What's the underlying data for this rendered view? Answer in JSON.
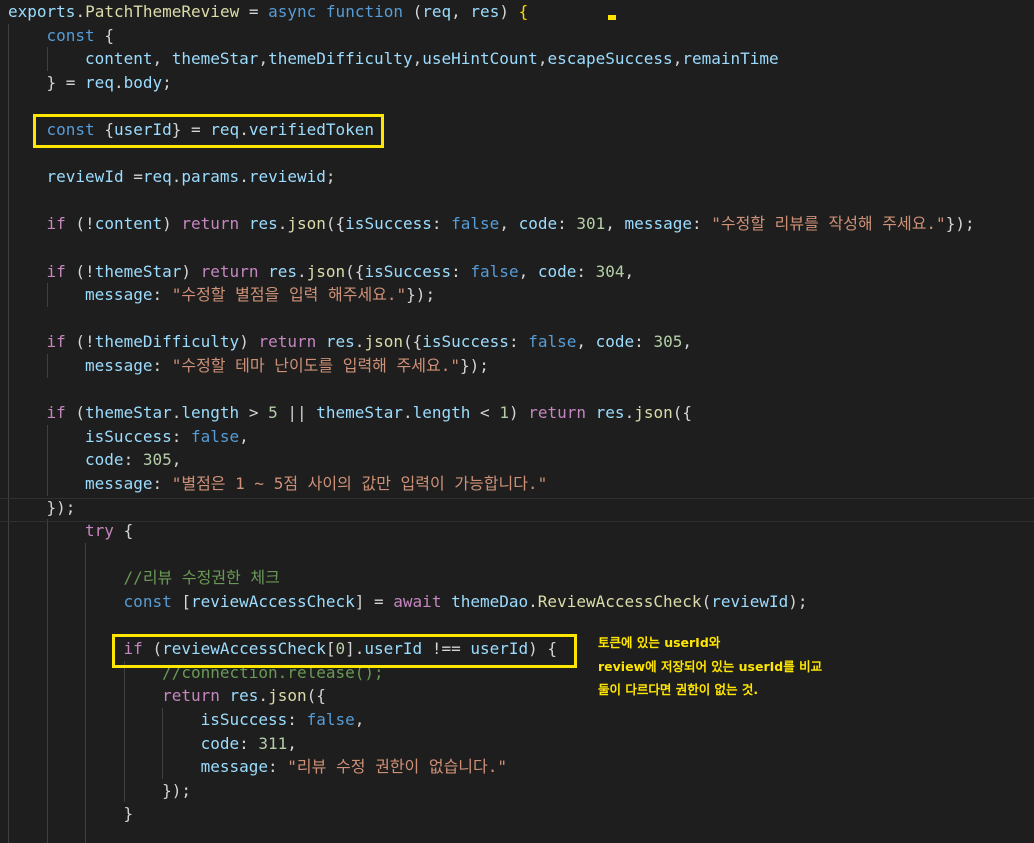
{
  "code_lines": [
    {
      "indent": 0,
      "tokens": [
        {
          "t": "exports",
          "c": "var"
        },
        {
          "t": ".",
          "c": "punc"
        },
        {
          "t": "PatchThemeReview",
          "c": "fn"
        },
        {
          "t": " = ",
          "c": "punc"
        },
        {
          "t": "async",
          "c": "kw"
        },
        {
          "t": " ",
          "c": "punc"
        },
        {
          "t": "function",
          "c": "kw"
        },
        {
          "t": " (",
          "c": "punc"
        },
        {
          "t": "req",
          "c": "var"
        },
        {
          "t": ", ",
          "c": "punc"
        },
        {
          "t": "res",
          "c": "var"
        },
        {
          "t": ") ",
          "c": "punc"
        },
        {
          "t": "{",
          "c": "brace"
        }
      ]
    },
    {
      "indent": 4,
      "tokens": [
        {
          "t": "const",
          "c": "kw"
        },
        {
          "t": " {",
          "c": "punc"
        }
      ]
    },
    {
      "indent": 8,
      "tokens": [
        {
          "t": "content",
          "c": "var"
        },
        {
          "t": ", ",
          "c": "punc"
        },
        {
          "t": "themeStar",
          "c": "var"
        },
        {
          "t": ",",
          "c": "punc"
        },
        {
          "t": "themeDifficulty",
          "c": "var"
        },
        {
          "t": ",",
          "c": "punc"
        },
        {
          "t": "useHintCount",
          "c": "var"
        },
        {
          "t": ",",
          "c": "punc"
        },
        {
          "t": "escapeSuccess",
          "c": "var"
        },
        {
          "t": ",",
          "c": "punc"
        },
        {
          "t": "remainTime",
          "c": "var"
        }
      ]
    },
    {
      "indent": 4,
      "tokens": [
        {
          "t": "} = ",
          "c": "punc"
        },
        {
          "t": "req",
          "c": "var"
        },
        {
          "t": ".",
          "c": "punc"
        },
        {
          "t": "body",
          "c": "prop"
        },
        {
          "t": ";",
          "c": "punc"
        }
      ]
    },
    {
      "indent": 0,
      "tokens": []
    },
    {
      "indent": 4,
      "tokens": [
        {
          "t": "const",
          "c": "kw"
        },
        {
          "t": " {",
          "c": "punc"
        },
        {
          "t": "userId",
          "c": "var"
        },
        {
          "t": "} = ",
          "c": "punc"
        },
        {
          "t": "req",
          "c": "var"
        },
        {
          "t": ".",
          "c": "punc"
        },
        {
          "t": "verifiedToken",
          "c": "prop"
        }
      ]
    },
    {
      "indent": 0,
      "tokens": []
    },
    {
      "indent": 4,
      "tokens": [
        {
          "t": "reviewId",
          "c": "var"
        },
        {
          "t": " =",
          "c": "punc"
        },
        {
          "t": "req",
          "c": "var"
        },
        {
          "t": ".",
          "c": "punc"
        },
        {
          "t": "params",
          "c": "prop"
        },
        {
          "t": ".",
          "c": "punc"
        },
        {
          "t": "reviewid",
          "c": "prop"
        },
        {
          "t": ";",
          "c": "punc"
        }
      ]
    },
    {
      "indent": 0,
      "tokens": []
    },
    {
      "indent": 4,
      "tokens": [
        {
          "t": "if",
          "c": "ctl"
        },
        {
          "t": " (!",
          "c": "punc"
        },
        {
          "t": "content",
          "c": "var"
        },
        {
          "t": ") ",
          "c": "punc"
        },
        {
          "t": "return",
          "c": "ctl"
        },
        {
          "t": " ",
          "c": "punc"
        },
        {
          "t": "res",
          "c": "var"
        },
        {
          "t": ".",
          "c": "punc"
        },
        {
          "t": "json",
          "c": "fn"
        },
        {
          "t": "({",
          "c": "punc"
        },
        {
          "t": "isSuccess",
          "c": "prop"
        },
        {
          "t": ": ",
          "c": "punc"
        },
        {
          "t": "false",
          "c": "kw"
        },
        {
          "t": ", ",
          "c": "punc"
        },
        {
          "t": "code",
          "c": "prop"
        },
        {
          "t": ": ",
          "c": "punc"
        },
        {
          "t": "301",
          "c": "num"
        },
        {
          "t": ", ",
          "c": "punc"
        },
        {
          "t": "message",
          "c": "prop"
        },
        {
          "t": ": ",
          "c": "punc"
        },
        {
          "t": "\"수정할 리뷰를 작성해 주세요.\"",
          "c": "str"
        },
        {
          "t": "});",
          "c": "punc"
        }
      ]
    },
    {
      "indent": 0,
      "tokens": []
    },
    {
      "indent": 4,
      "tokens": [
        {
          "t": "if",
          "c": "ctl"
        },
        {
          "t": " (!",
          "c": "punc"
        },
        {
          "t": "themeStar",
          "c": "var"
        },
        {
          "t": ") ",
          "c": "punc"
        },
        {
          "t": "return",
          "c": "ctl"
        },
        {
          "t": " ",
          "c": "punc"
        },
        {
          "t": "res",
          "c": "var"
        },
        {
          "t": ".",
          "c": "punc"
        },
        {
          "t": "json",
          "c": "fn"
        },
        {
          "t": "({",
          "c": "punc"
        },
        {
          "t": "isSuccess",
          "c": "prop"
        },
        {
          "t": ": ",
          "c": "punc"
        },
        {
          "t": "false",
          "c": "kw"
        },
        {
          "t": ", ",
          "c": "punc"
        },
        {
          "t": "code",
          "c": "prop"
        },
        {
          "t": ": ",
          "c": "punc"
        },
        {
          "t": "304",
          "c": "num"
        },
        {
          "t": ",",
          "c": "punc"
        }
      ]
    },
    {
      "indent": 8,
      "tokens": [
        {
          "t": "message",
          "c": "prop"
        },
        {
          "t": ": ",
          "c": "punc"
        },
        {
          "t": "\"수정할 별점을 입력 해주세요.\"",
          "c": "str"
        },
        {
          "t": "});",
          "c": "punc"
        }
      ]
    },
    {
      "indent": 0,
      "tokens": []
    },
    {
      "indent": 4,
      "tokens": [
        {
          "t": "if",
          "c": "ctl"
        },
        {
          "t": " (!",
          "c": "punc"
        },
        {
          "t": "themeDifficulty",
          "c": "var"
        },
        {
          "t": ") ",
          "c": "punc"
        },
        {
          "t": "return",
          "c": "ctl"
        },
        {
          "t": " ",
          "c": "punc"
        },
        {
          "t": "res",
          "c": "var"
        },
        {
          "t": ".",
          "c": "punc"
        },
        {
          "t": "json",
          "c": "fn"
        },
        {
          "t": "({",
          "c": "punc"
        },
        {
          "t": "isSuccess",
          "c": "prop"
        },
        {
          "t": ": ",
          "c": "punc"
        },
        {
          "t": "false",
          "c": "kw"
        },
        {
          "t": ", ",
          "c": "punc"
        },
        {
          "t": "code",
          "c": "prop"
        },
        {
          "t": ": ",
          "c": "punc"
        },
        {
          "t": "305",
          "c": "num"
        },
        {
          "t": ",",
          "c": "punc"
        }
      ]
    },
    {
      "indent": 8,
      "tokens": [
        {
          "t": "message",
          "c": "prop"
        },
        {
          "t": ": ",
          "c": "punc"
        },
        {
          "t": "\"수정할 테마 난이도를 입력해 주세요.\"",
          "c": "str"
        },
        {
          "t": "});",
          "c": "punc"
        }
      ]
    },
    {
      "indent": 0,
      "tokens": []
    },
    {
      "indent": 4,
      "tokens": [
        {
          "t": "if",
          "c": "ctl"
        },
        {
          "t": " (",
          "c": "punc"
        },
        {
          "t": "themeStar",
          "c": "var"
        },
        {
          "t": ".",
          "c": "punc"
        },
        {
          "t": "length",
          "c": "prop"
        },
        {
          "t": " > ",
          "c": "punc"
        },
        {
          "t": "5",
          "c": "num"
        },
        {
          "t": " || ",
          "c": "punc"
        },
        {
          "t": "themeStar",
          "c": "var"
        },
        {
          "t": ".",
          "c": "punc"
        },
        {
          "t": "length",
          "c": "prop"
        },
        {
          "t": " < ",
          "c": "punc"
        },
        {
          "t": "1",
          "c": "num"
        },
        {
          "t": ") ",
          "c": "punc"
        },
        {
          "t": "return",
          "c": "ctl"
        },
        {
          "t": " ",
          "c": "punc"
        },
        {
          "t": "res",
          "c": "var"
        },
        {
          "t": ".",
          "c": "punc"
        },
        {
          "t": "json",
          "c": "fn"
        },
        {
          "t": "({",
          "c": "punc"
        }
      ]
    },
    {
      "indent": 8,
      "tokens": [
        {
          "t": "isSuccess",
          "c": "prop"
        },
        {
          "t": ": ",
          "c": "punc"
        },
        {
          "t": "false",
          "c": "kw"
        },
        {
          "t": ",",
          "c": "punc"
        }
      ]
    },
    {
      "indent": 8,
      "tokens": [
        {
          "t": "code",
          "c": "prop"
        },
        {
          "t": ": ",
          "c": "punc"
        },
        {
          "t": "305",
          "c": "num"
        },
        {
          "t": ",",
          "c": "punc"
        }
      ]
    },
    {
      "indent": 8,
      "tokens": [
        {
          "t": "message",
          "c": "prop"
        },
        {
          "t": ": ",
          "c": "punc"
        },
        {
          "t": "\"별점은 1 ~ 5점 사이의 값만 입력이 가능합니다.\"",
          "c": "str"
        }
      ]
    },
    {
      "indent": 4,
      "tokens": [
        {
          "t": "});",
          "c": "punc"
        }
      ]
    },
    {
      "indent": 8,
      "tokens": [
        {
          "t": "try",
          "c": "ctl"
        },
        {
          "t": " {",
          "c": "punc"
        }
      ]
    },
    {
      "indent": 0,
      "tokens": []
    },
    {
      "indent": 12,
      "tokens": [
        {
          "t": "//리뷰 수정권한 체크",
          "c": "cmt"
        }
      ]
    },
    {
      "indent": 12,
      "tokens": [
        {
          "t": "const",
          "c": "kw"
        },
        {
          "t": " [",
          "c": "punc"
        },
        {
          "t": "reviewAccessCheck",
          "c": "var"
        },
        {
          "t": "] = ",
          "c": "punc"
        },
        {
          "t": "await",
          "c": "ctl"
        },
        {
          "t": " ",
          "c": "punc"
        },
        {
          "t": "themeDao",
          "c": "var"
        },
        {
          "t": ".",
          "c": "punc"
        },
        {
          "t": "ReviewAccessCheck",
          "c": "fn"
        },
        {
          "t": "(",
          "c": "punc"
        },
        {
          "t": "reviewId",
          "c": "var"
        },
        {
          "t": ");",
          "c": "punc"
        }
      ]
    },
    {
      "indent": 0,
      "tokens": []
    },
    {
      "indent": 12,
      "tokens": [
        {
          "t": "if",
          "c": "ctl"
        },
        {
          "t": " (",
          "c": "punc"
        },
        {
          "t": "reviewAccessCheck",
          "c": "var"
        },
        {
          "t": "[",
          "c": "punc"
        },
        {
          "t": "0",
          "c": "num"
        },
        {
          "t": "].",
          "c": "punc"
        },
        {
          "t": "userId",
          "c": "prop"
        },
        {
          "t": " !== ",
          "c": "punc"
        },
        {
          "t": "userId",
          "c": "var"
        },
        {
          "t": ") {",
          "c": "punc"
        }
      ]
    },
    {
      "indent": 16,
      "tokens": [
        {
          "t": "//connection.release();",
          "c": "cmt"
        }
      ]
    },
    {
      "indent": 16,
      "tokens": [
        {
          "t": "return",
          "c": "ctl"
        },
        {
          "t": " ",
          "c": "punc"
        },
        {
          "t": "res",
          "c": "var"
        },
        {
          "t": ".",
          "c": "punc"
        },
        {
          "t": "json",
          "c": "fn"
        },
        {
          "t": "({",
          "c": "punc"
        }
      ]
    },
    {
      "indent": 20,
      "tokens": [
        {
          "t": "isSuccess",
          "c": "prop"
        },
        {
          "t": ": ",
          "c": "punc"
        },
        {
          "t": "false",
          "c": "kw"
        },
        {
          "t": ",",
          "c": "punc"
        }
      ]
    },
    {
      "indent": 20,
      "tokens": [
        {
          "t": "code",
          "c": "prop"
        },
        {
          "t": ": ",
          "c": "punc"
        },
        {
          "t": "311",
          "c": "num"
        },
        {
          "t": ",",
          "c": "punc"
        }
      ]
    },
    {
      "indent": 20,
      "tokens": [
        {
          "t": "message",
          "c": "prop"
        },
        {
          "t": ": ",
          "c": "punc"
        },
        {
          "t": "\"리뷰 수정 권한이 없습니다.\"",
          "c": "str"
        }
      ]
    },
    {
      "indent": 16,
      "tokens": [
        {
          "t": "});",
          "c": "punc"
        }
      ]
    },
    {
      "indent": 12,
      "tokens": [
        {
          "t": "}",
          "c": "punc"
        }
      ]
    }
  ],
  "annotation": {
    "lines": [
      "토큰에 있는 userId와",
      "review에 저장되어 있는 userId를 비교",
      "둘이 다르다면 권한이 없는 것."
    ]
  },
  "colors": {
    "background": "#1e1e1e",
    "highlight": "#ffe600"
  }
}
